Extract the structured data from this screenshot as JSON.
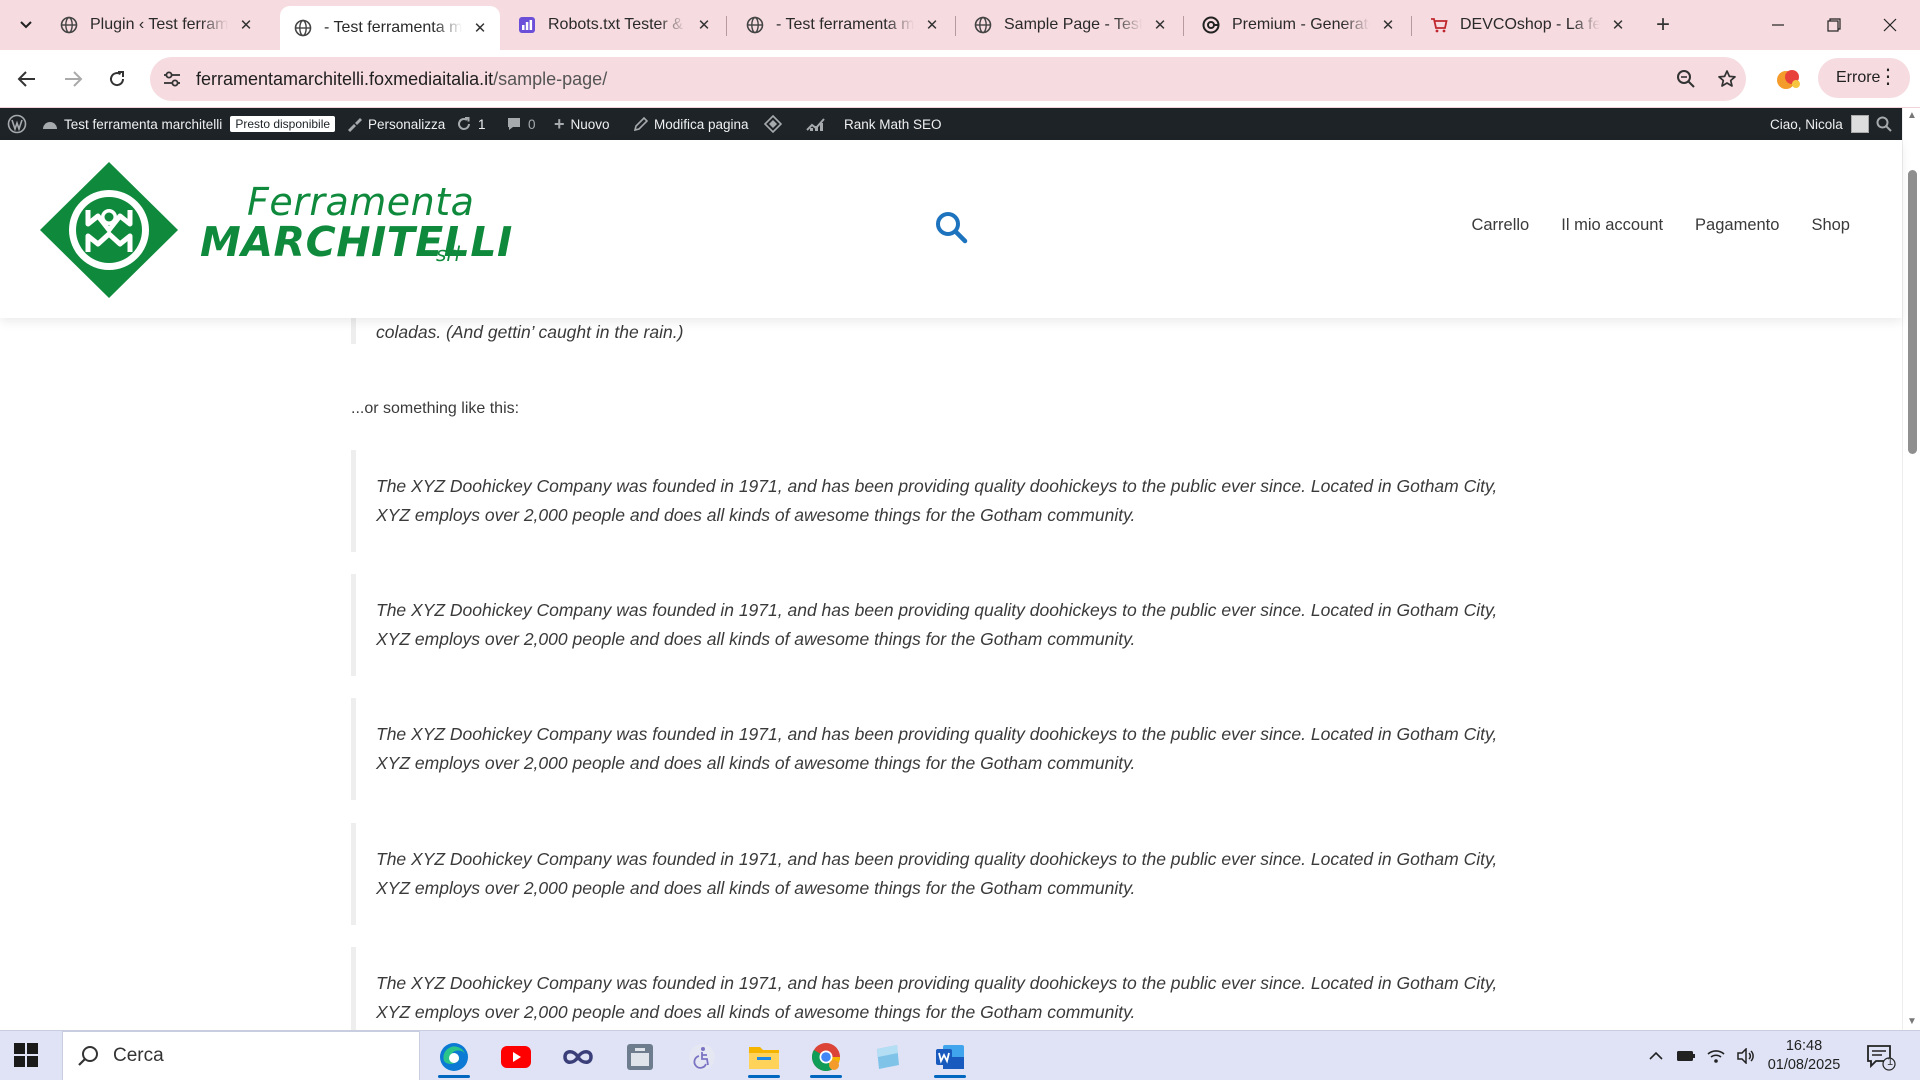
{
  "browser": {
    "tabs": [
      {
        "label": "Plugin ‹ Test ferramenta marchitelli",
        "favicon": "globe-icon",
        "active": false
      },
      {
        "label": "- Test ferramenta marchitelli",
        "favicon": "globe-icon",
        "active": true
      },
      {
        "label": "Robots.txt Tester & Validator",
        "favicon": "robots-favicon",
        "active": false
      },
      {
        "label": "- Test ferramenta marchitelli",
        "favicon": "globe-icon",
        "active": false
      },
      {
        "label": "Sample Page - Test ferramenta",
        "favicon": "globe-icon",
        "active": false
      },
      {
        "label": "Premium - GeneratePress",
        "favicon": "generatepress-icon",
        "active": false
      },
      {
        "label": "DEVCOshop - La ferramenta online",
        "favicon": "cart-icon",
        "active": false
      }
    ],
    "url_domain": "ferramentamarchitelli.foxmediaitalia.it",
    "url_path": "/sample-page/",
    "profile_label": "Errore",
    "accent": "#f6dbe0"
  },
  "adminbar": {
    "site_name": "Test ferramenta marchitelli",
    "badge": "Presto disponibile",
    "customize": "Personalizza",
    "updates_count": "1",
    "comments_count": "0",
    "new_label": "Nuovo",
    "edit_page": "Modifica pagina",
    "rank_math": "Rank Math SEO",
    "greeting": "Ciao, Nicola"
  },
  "site": {
    "logo_line1": "Ferramenta",
    "logo_line2": "MARCHITELLI",
    "logo_suffix": "srl",
    "brand_color": "#0f8a3c",
    "nav": [
      "Carrello",
      "Il mio account",
      "Pagamento",
      "Shop"
    ]
  },
  "content": {
    "quote_tail": "coladas. (And gettin’ caught in the rain.)",
    "intro": "...or something like this:",
    "quotes": [
      "The XYZ Doohickey Company was founded in 1971, and has been providing quality doohickeys to the public ever since. Located in Gotham City, XYZ employs over 2,000 people and does all kinds of awesome things for the Gotham community.",
      "The XYZ Doohickey Company was founded in 1971, and has been providing quality doohickeys to the public ever since. Located in Gotham City, XYZ employs over 2,000 people and does all kinds of awesome things for the Gotham community.",
      "The XYZ Doohickey Company was founded in 1971, and has been providing quality doohickeys to the public ever since. Located in Gotham City, XYZ employs over 2,000 people and does all kinds of awesome things for the Gotham community.",
      "The XYZ Doohickey Company was founded in 1971, and has been providing quality doohickeys to the public ever since. Located in Gotham City, XYZ employs over 2,000 people and does all kinds of awesome things for the Gotham community.",
      "The XYZ Doohickey Company was founded in 1971, and has been providing quality doohickeys to the public ever since. Located in Gotham City, XYZ employs over 2,000 people and does all kinds of awesome things for the Gotham community."
    ]
  },
  "taskbar": {
    "search_label": "Cerca",
    "apps": [
      "edge-icon",
      "youtube-icon",
      "infinity-app-icon",
      "calendar-app-icon",
      "accessibility-app-icon",
      "file-explorer-icon",
      "chrome-icon",
      "notepad-app-icon",
      "word-icon"
    ],
    "time": "16:48",
    "date": "01/08/2025",
    "notifications": "1"
  }
}
